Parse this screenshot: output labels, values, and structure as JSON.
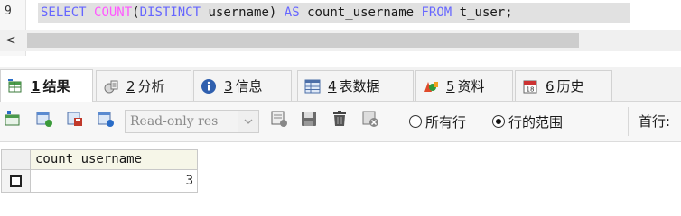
{
  "editor": {
    "line_number": "9",
    "sql_tokens": [
      {
        "text": "SELECT ",
        "kind": "kw"
      },
      {
        "text": "COUNT",
        "kind": "fn"
      },
      {
        "text": "(",
        "kind": "tx"
      },
      {
        "text": "DISTINCT ",
        "kind": "kw"
      },
      {
        "text": "username) ",
        "kind": "tx"
      },
      {
        "text": "AS ",
        "kind": "kw"
      },
      {
        "text": "count_username ",
        "kind": "tx"
      },
      {
        "text": "FROM ",
        "kind": "kw"
      },
      {
        "text": "t_user;",
        "kind": "tx"
      }
    ],
    "scroll_left_glyph": "<"
  },
  "result_tabs": [
    {
      "num": "1",
      "label": "结果",
      "icon": "result-icon",
      "active": true
    },
    {
      "num": "2",
      "label": "分析",
      "icon": "profile-icon",
      "active": false
    },
    {
      "num": "3",
      "label": "信息",
      "icon": "info-icon",
      "active": false
    },
    {
      "num": "4",
      "label": "表数据",
      "icon": "table-data-icon",
      "active": false
    },
    {
      "num": "5",
      "label": "资料",
      "icon": "chart-info-icon",
      "active": false
    },
    {
      "num": "6",
      "label": "历史",
      "icon": "history-icon",
      "active": false
    }
  ],
  "toolbar": {
    "mode_select_value": "Read-only res",
    "radio_all_rows": "所有行",
    "radio_row_range": "行的范围",
    "radio_selected": "row_range",
    "first_row_label": "首行:"
  },
  "grid": {
    "columns": [
      "count_username"
    ],
    "rows": [
      [
        "3"
      ]
    ]
  },
  "colors": {
    "keyword": "#6666ff",
    "function": "#ff59ff",
    "code_highlight": "#e1e1e1"
  }
}
